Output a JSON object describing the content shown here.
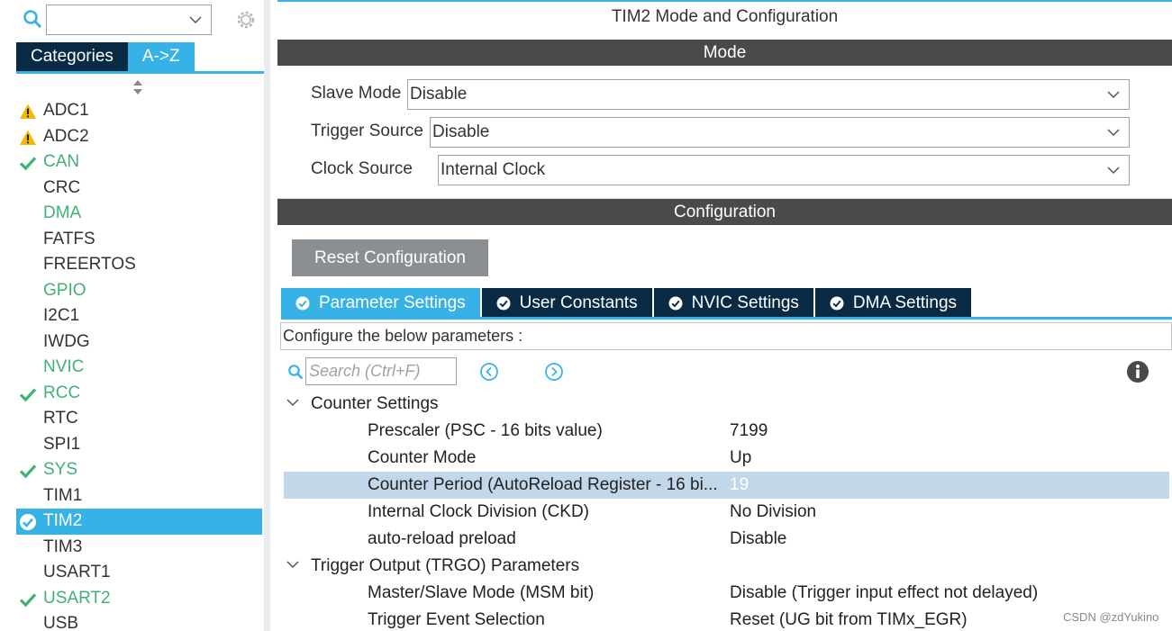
{
  "left_panel": {
    "tabs": [
      {
        "label": "Categories",
        "active": false
      },
      {
        "label": "A->Z",
        "active": true
      }
    ],
    "items": [
      {
        "label": "ADC1",
        "status": "warning"
      },
      {
        "label": "ADC2",
        "status": "warning"
      },
      {
        "label": "CAN",
        "status": "ok"
      },
      {
        "label": "CRC",
        "status": "none"
      },
      {
        "label": "DMA",
        "status": "green"
      },
      {
        "label": "FATFS",
        "status": "none"
      },
      {
        "label": "FREERTOS",
        "status": "none"
      },
      {
        "label": "GPIO",
        "status": "green"
      },
      {
        "label": "I2C1",
        "status": "none"
      },
      {
        "label": "IWDG",
        "status": "none"
      },
      {
        "label": "NVIC",
        "status": "green"
      },
      {
        "label": "RCC",
        "status": "ok"
      },
      {
        "label": "RTC",
        "status": "none"
      },
      {
        "label": "SPI1",
        "status": "none"
      },
      {
        "label": "SYS",
        "status": "ok"
      },
      {
        "label": "TIM1",
        "status": "none"
      },
      {
        "label": "TIM2",
        "status": "selected"
      },
      {
        "label": "TIM3",
        "status": "none"
      },
      {
        "label": "USART1",
        "status": "none"
      },
      {
        "label": "USART2",
        "status": "ok"
      },
      {
        "label": "USB",
        "status": "none"
      }
    ]
  },
  "main": {
    "title": "TIM2 Mode and Configuration",
    "mode_header": "Mode",
    "config_header": "Configuration",
    "mode_fields": [
      {
        "label": "Slave Mode",
        "value": "Disable"
      },
      {
        "label": "Trigger Source",
        "value": "Disable"
      },
      {
        "label": "Clock Source",
        "value": "Internal Clock"
      }
    ],
    "reset_label": "Reset Configuration",
    "tabs": [
      {
        "label": "Parameter Settings",
        "active": true
      },
      {
        "label": "User Constants",
        "active": false
      },
      {
        "label": "NVIC Settings",
        "active": false
      },
      {
        "label": "DMA Settings",
        "active": false
      }
    ],
    "description": "Configure the below parameters :",
    "search_placeholder": "Search (Ctrl+F)",
    "groups": [
      {
        "label": "Counter Settings",
        "params": [
          {
            "name": "Prescaler (PSC - 16 bits value)",
            "value": "7199"
          },
          {
            "name": "Counter Mode",
            "value": "Up"
          },
          {
            "name": "Counter Period (AutoReload Register - 16 bi...",
            "value": "19",
            "selected": true
          },
          {
            "name": "Internal Clock Division (CKD)",
            "value": "No Division"
          },
          {
            "name": "auto-reload preload",
            "value": "Disable"
          }
        ]
      },
      {
        "label": "Trigger Output (TRGO) Parameters",
        "params": [
          {
            "name": "Master/Slave Mode (MSM bit)",
            "value": "Disable (Trigger input effect not delayed)"
          },
          {
            "name": "Trigger Event Selection",
            "value": "Reset (UG bit from TIMx_EGR)"
          }
        ]
      }
    ]
  },
  "watermark": "CSDN @zdYukino",
  "colors": {
    "accent": "#37b2e6",
    "navy": "#082a44",
    "green": "#3fb277",
    "warning": "#f5b800"
  }
}
